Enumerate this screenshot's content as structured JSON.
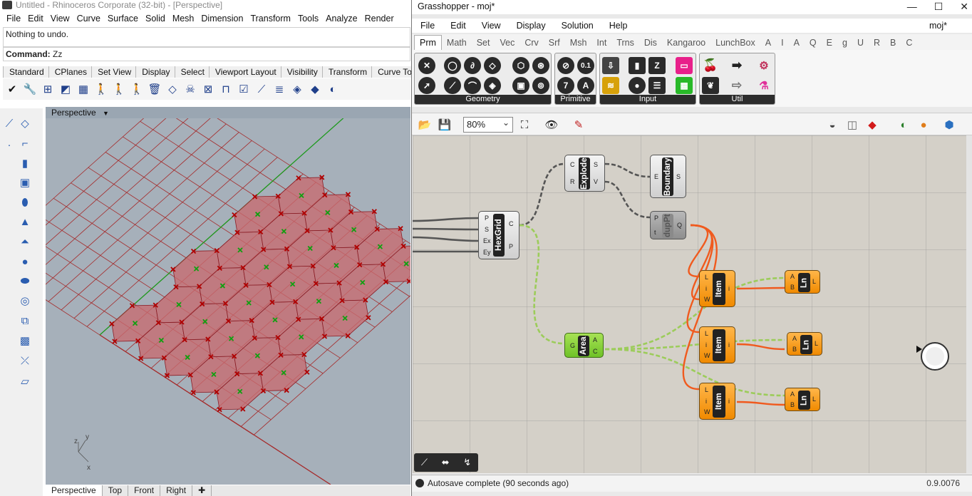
{
  "rhino": {
    "title": "Untitled - Rhinoceros Corporate (32-bit) - [Perspective]",
    "menu": [
      "File",
      "Edit",
      "View",
      "Curve",
      "Surface",
      "Solid",
      "Mesh",
      "Dimension",
      "Transform",
      "Tools",
      "Analyze",
      "Render"
    ],
    "history_text": "Nothing to undo.",
    "command_label": "Command:",
    "command_value": "Zz",
    "toolbar_tabs": [
      "Standard",
      "CPlanes",
      "Set View",
      "Display",
      "Select",
      "Viewport Layout",
      "Visibility",
      "Transform",
      "Curve Tools"
    ],
    "viewport_title": "Perspective",
    "viewport_tabs": [
      "Perspective",
      "Top",
      "Front",
      "Right"
    ],
    "axis": {
      "x": "x",
      "y": "y",
      "z": "z"
    }
  },
  "gh": {
    "title": "Grasshopper - moj*",
    "menu": [
      "File",
      "Edit",
      "View",
      "Display",
      "Solution",
      "Help"
    ],
    "doc_label": "moj*",
    "tabs": [
      "Prm",
      "Math",
      "Set",
      "Vec",
      "Crv",
      "Srf",
      "Msh",
      "Int",
      "Trns",
      "Dis",
      "Kangaroo",
      "LunchBox",
      "A",
      "I",
      "A",
      "Q",
      "E",
      "g",
      "U",
      "R",
      "B",
      "C"
    ],
    "ribbon_groups": [
      "Geometry",
      "Primitive",
      "Input",
      "Util"
    ],
    "primitive_number": "0.1",
    "primitive_seven": "7",
    "primitive_a": "A",
    "zoom": "80%",
    "status": "Autosave complete (90 seconds ago)",
    "version": "0.9.0076",
    "components": {
      "hexgrid": {
        "name": "HexGrid",
        "inputs": [
          "P",
          "S",
          "Ex",
          "Ey"
        ],
        "outputs": [
          "C",
          "P"
        ]
      },
      "explode": {
        "name": "Explode",
        "inputs": [
          "C",
          "R"
        ],
        "outputs": [
          "S",
          "V"
        ]
      },
      "boundary": {
        "name": "Boundary",
        "inputs": [
          "E"
        ],
        "outputs": [
          "S"
        ]
      },
      "duppt": {
        "name": "dupPt",
        "inputs": [
          "P",
          "t"
        ],
        "outputs": [
          "Q"
        ]
      },
      "area": {
        "name": "Area",
        "inputs": [
          "G"
        ],
        "outputs": [
          "A",
          "C"
        ]
      },
      "item1": {
        "name": "Item",
        "inputs": [
          "L",
          "i",
          "W"
        ],
        "outputs": [
          "i"
        ]
      },
      "item2": {
        "name": "Item",
        "inputs": [
          "L",
          "i",
          "W"
        ],
        "outputs": [
          "i"
        ]
      },
      "item3": {
        "name": "Item",
        "inputs": [
          "L",
          "i",
          "W"
        ],
        "outputs": [
          "i"
        ]
      },
      "ln1": {
        "name": "Ln",
        "inputs": [
          "A",
          "B"
        ],
        "outputs": [
          "L"
        ]
      },
      "ln2": {
        "name": "Ln",
        "inputs": [
          "A",
          "B"
        ],
        "outputs": [
          "L"
        ]
      },
      "ln3": {
        "name": "Ln",
        "inputs": [
          "A",
          "B"
        ],
        "outputs": [
          "L"
        ]
      }
    }
  },
  "colors": {
    "hex_fill": "#c86a70",
    "hex_edge": "#8a1f27",
    "grid_line": "#a52a2a",
    "y_axis": "#1e9a1e",
    "marker_x": "#b00000",
    "centroid": "#10a010",
    "wire_orange": "#f05a1e",
    "wire_green": "#9ccc5a",
    "wire_dark": "#555555"
  }
}
